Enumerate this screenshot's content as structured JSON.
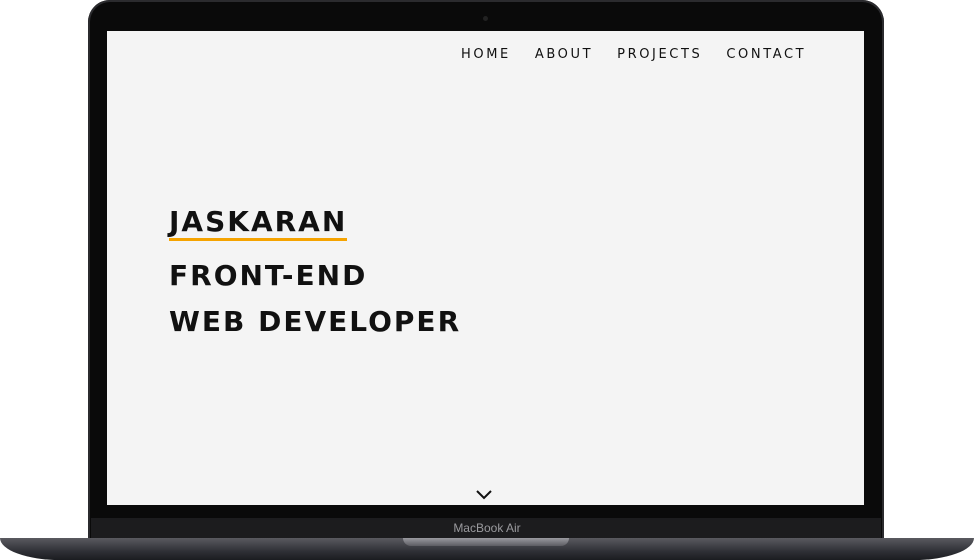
{
  "nav": {
    "items": [
      {
        "label": "HOME"
      },
      {
        "label": "ABOUT"
      },
      {
        "label": "PROJECTS"
      },
      {
        "label": "CONTACT"
      }
    ]
  },
  "hero": {
    "name": "JASKARAN",
    "line2": "FRONT-END",
    "line3": "WEB DEVELOPER"
  },
  "scroll_icon": "chevron-down-icon",
  "device": {
    "label": "MacBook Air"
  },
  "colors": {
    "accent": "#f5a300",
    "background": "#f4f4f4",
    "text": "#111111"
  }
}
